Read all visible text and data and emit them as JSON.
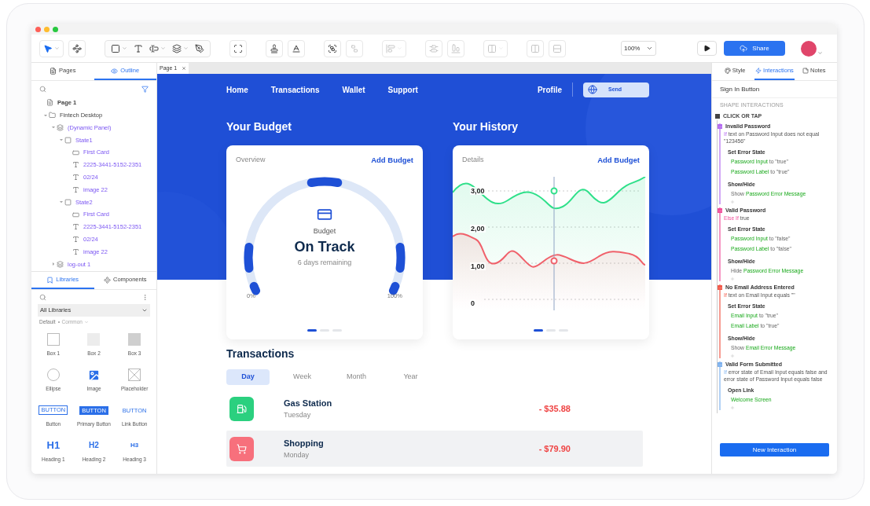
{
  "toolbar": {
    "groups": [
      {
        "boxed": false,
        "tools": [
          {
            "kind": "pointer",
            "menu": true,
            "disabled": false,
            "active": true
          },
          {
            "kind": "connector",
            "menu": false,
            "disabled": false,
            "active": false
          }
        ]
      },
      {
        "boxed": true,
        "tools": [
          {
            "kind": "rectangle",
            "menu": true,
            "disabled": false,
            "active": false
          },
          {
            "kind": "text",
            "menu": false,
            "disabled": false,
            "active": false
          },
          {
            "kind": "input",
            "menu": true,
            "disabled": false,
            "active": false
          },
          {
            "kind": "layers",
            "menu": true,
            "disabled": false,
            "active": false
          },
          {
            "kind": "pen",
            "menu": false,
            "disabled": false,
            "active": false
          }
        ]
      },
      {
        "boxed": false,
        "tools": [
          {
            "kind": "frame",
            "menu": false,
            "disabled": false,
            "active": false
          }
        ]
      },
      {
        "boxed": false,
        "tools": [
          {
            "kind": "stamp",
            "menu": false,
            "disabled": false,
            "active": false
          },
          {
            "kind": "style",
            "menu": false,
            "disabled": false,
            "active": false
          }
        ]
      },
      {
        "boxed": false,
        "tools": [
          {
            "kind": "group",
            "menu": false,
            "disabled": false,
            "active": false
          },
          {
            "kind": "ungroup",
            "menu": false,
            "disabled": true,
            "active": false
          }
        ]
      },
      {
        "boxed": false,
        "tools": [
          {
            "kind": "align",
            "menu": true,
            "disabled": true,
            "active": false
          }
        ]
      },
      {
        "boxed": false,
        "tools": [
          {
            "kind": "distribute",
            "menu": false,
            "disabled": true,
            "active": false
          },
          {
            "kind": "align-bottom",
            "menu": false,
            "disabled": true,
            "active": false
          }
        ]
      },
      {
        "boxed": false,
        "tools": [
          {
            "kind": "columns",
            "menu": true,
            "disabled": true,
            "active": false
          }
        ]
      },
      {
        "boxed": false,
        "tools": [
          {
            "kind": "columns",
            "menu": false,
            "disabled": true,
            "active": false
          },
          {
            "kind": "rows",
            "menu": false,
            "disabled": true,
            "active": false
          }
        ]
      }
    ],
    "zoom": "100%",
    "share": "Share"
  },
  "left_panel": {
    "tabs": [
      {
        "label": "Pages",
        "kind": "pages",
        "selected": false
      },
      {
        "label": "Outline",
        "kind": "outline",
        "selected": true
      }
    ],
    "outline": [
      {
        "label": "Page 1",
        "kind": "page",
        "children": [
          {
            "label": "Fintech Desktop",
            "kind": "folder",
            "expanded": true,
            "children": [
              {
                "label": "(Dynamic Panel)",
                "kind": "panel",
                "expanded": true,
                "children": [
                  {
                    "label": "State1",
                    "kind": "state",
                    "expanded": true,
                    "children": [
                      {
                        "label": "First Card",
                        "kind": "shape"
                      },
                      {
                        "label": "2225-3441-5152-2351",
                        "kind": "text"
                      },
                      {
                        "label": "02/24",
                        "kind": "text"
                      },
                      {
                        "label": "image 22",
                        "kind": "text"
                      }
                    ]
                  },
                  {
                    "label": "State2",
                    "kind": "state",
                    "expanded": true,
                    "children": [
                      {
                        "label": "First Card",
                        "kind": "shape"
                      },
                      {
                        "label": "2225-3441-5152-2351",
                        "kind": "text"
                      },
                      {
                        "label": "02/24",
                        "kind": "text"
                      },
                      {
                        "label": "image 22",
                        "kind": "text"
                      }
                    ]
                  }
                ]
              },
              {
                "label": "log-out 1",
                "kind": "panel",
                "expanded": false
              }
            ]
          }
        ]
      }
    ],
    "library_tabs": [
      {
        "label": "Libraries",
        "kind": "libraries",
        "selected": true
      },
      {
        "label": "Components",
        "kind": "components",
        "selected": false
      }
    ],
    "library_select": "All Libraries",
    "library_source": "Default",
    "library_group": "Common",
    "widgets": [
      {
        "label": "Box 1",
        "kind": "box-outline"
      },
      {
        "label": "Box 2",
        "kind": "box-light"
      },
      {
        "label": "Box 3",
        "kind": "box-dark"
      },
      {
        "label": "Ellipse",
        "kind": "ellipse"
      },
      {
        "label": "Image",
        "kind": "image"
      },
      {
        "label": "Placeholder",
        "kind": "placeholder"
      },
      {
        "label": "Button",
        "kind": "button",
        "preview_text": "BUTTON"
      },
      {
        "label": "Primary Button",
        "kind": "primary-button",
        "preview_text": "BUTTON"
      },
      {
        "label": "Link Button",
        "kind": "link-button",
        "preview_text": "BUTTON"
      },
      {
        "label": "Heading 1",
        "kind": "heading1",
        "preview_text": "H1"
      },
      {
        "label": "Heading 2",
        "kind": "heading2",
        "preview_text": "H2"
      },
      {
        "label": "Heading 3",
        "kind": "heading3",
        "preview_text": "H3"
      }
    ]
  },
  "canvas": {
    "tabs": [
      {
        "label": "Page 1",
        "selected": true
      }
    ],
    "nav": [
      "Home",
      "Transactions",
      "Wallet",
      "Support"
    ],
    "profile": "Profile",
    "send": "Send",
    "budget": {
      "title": "Your Budget",
      "card_label": "Overview",
      "action": "Add Budget",
      "caption": "Budget",
      "status": "On Track",
      "remaining": "6 days remaining",
      "min": "0%",
      "max": "100%",
      "pager": [
        {
          "selected": true
        },
        {
          "selected": false
        },
        {
          "selected": false
        }
      ]
    },
    "history": {
      "title": "Your History",
      "card_label": "Details",
      "action": "Add Budget",
      "y_labels": [
        "3,00",
        "2,00",
        "1,00",
        "0"
      ],
      "pager": [
        {
          "selected": true
        },
        {
          "selected": false
        },
        {
          "selected": false
        }
      ]
    },
    "transactions": {
      "title": "Transactions",
      "periods": [
        {
          "label": "Day",
          "selected": true
        },
        {
          "label": "Week",
          "selected": false
        },
        {
          "label": "Month",
          "selected": false
        },
        {
          "label": "Year",
          "selected": false
        }
      ],
      "rows": [
        {
          "name": "Gas Station",
          "day": "Tuesday",
          "amount": "- $35.88",
          "kind": "fuel",
          "color": "#2bd07f",
          "selected": false
        },
        {
          "name": "Shopping",
          "day": "Monday",
          "amount": "- $79.90",
          "kind": "cart",
          "color": "#f7707c",
          "selected": true
        }
      ]
    }
  },
  "right_panel": {
    "tabs": [
      {
        "label": "Style",
        "kind": "style",
        "selected": false
      },
      {
        "label": "Interactions",
        "kind": "interactions",
        "selected": true
      },
      {
        "label": "Notes",
        "kind": "notes",
        "selected": false
      }
    ],
    "element": "Sign In Button",
    "section": "SHAPE INTERACTIONS",
    "event": "CLICK OR TAP",
    "cases": [
      {
        "title": "Invalid Password",
        "color": "#b46cf0",
        "keyword": "If",
        "condition": "text on Password Input does not equal \"123456\"",
        "actions": [
          {
            "name": "Set Error State",
            "lines": [
              {
                "target": "Password Input",
                "suffix": "to \"true\""
              },
              {
                "target": "Password Label",
                "suffix": "to \"true\""
              }
            ]
          },
          {
            "name": "Show/Hide",
            "lines": [
              {
                "prefix": "Show",
                "target": "Password Error Message"
              }
            ]
          }
        ]
      },
      {
        "title": "Valid Password",
        "color": "#f0509b",
        "keyword": "Else If",
        "condition": "true",
        "actions": [
          {
            "name": "Set Error State",
            "lines": [
              {
                "target": "Password Input",
                "suffix": "to \"false\""
              },
              {
                "target": "Password Label",
                "suffix": "to \"false\""
              }
            ]
          },
          {
            "name": "Show/Hide",
            "lines": [
              {
                "prefix": "Hide",
                "target": "Password Error Message"
              }
            ]
          }
        ]
      },
      {
        "title": "No Email Address Entered",
        "color": "#f25a4a",
        "keyword": "If",
        "condition": "text on Email Input equals \"\"",
        "actions": [
          {
            "name": "Set Error State",
            "lines": [
              {
                "target": "Email Input",
                "suffix": "to \"true\""
              },
              {
                "target": "Email Label",
                "suffix": "to \"true\""
              }
            ]
          },
          {
            "name": "Show/Hide",
            "lines": [
              {
                "prefix": "Show",
                "target": "Email Error Message"
              }
            ]
          }
        ]
      },
      {
        "title": "Valid Form Submitted",
        "color": "#7fb2ee",
        "keyword": "If",
        "condition": "error state of Email Input equals false and error state of Password Input equals false",
        "actions": [
          {
            "name": "Open Link",
            "lines": [
              {
                "target": "Welcome Screen"
              }
            ]
          }
        ]
      }
    ],
    "new_button": "New Interaction"
  }
}
